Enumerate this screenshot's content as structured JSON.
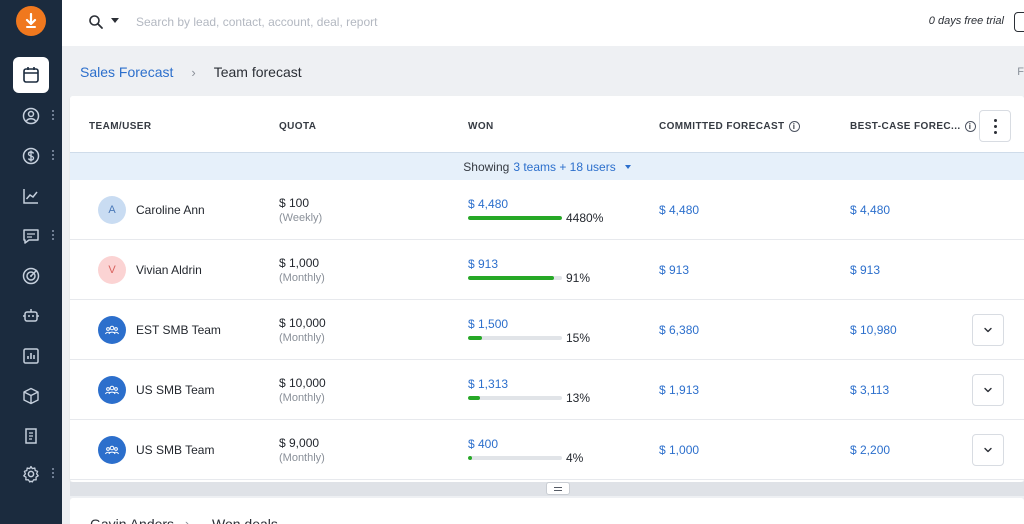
{
  "search": {
    "placeholder": "Search by lead, contact, account, deal, report"
  },
  "trial": {
    "text": "0 days free trial"
  },
  "breadcrumb": {
    "parent": "Sales Forecast",
    "separator": "›",
    "current": "Team forecast"
  },
  "edge_text": "F",
  "table": {
    "headers": {
      "team_user": "TEAM/USER",
      "quota": "QUOTA",
      "won": "WON",
      "committed": "COMMITTED FORECAST",
      "best_case": "BEST-CASE FOREC..."
    },
    "info_glyph": "i",
    "showing": {
      "prefix": "Showing",
      "link": "3 teams + 18 users"
    },
    "rows": [
      {
        "type": "user",
        "initial": "A",
        "name": "Caroline Ann",
        "quota": "$ 100",
        "period": "(Weekly)",
        "won": "$ 4,480",
        "won_pct": "4480%",
        "progress": 1.0,
        "committed": "$ 4,480",
        "best_case": "$ 4,480"
      },
      {
        "type": "user",
        "initial": "V",
        "name": "Vivian Aldrin",
        "quota": "$ 1,000",
        "period": "(Monthly)",
        "won": "$ 913",
        "won_pct": "91%",
        "progress": 0.91,
        "committed": "$ 913",
        "best_case": "$ 913"
      },
      {
        "type": "team",
        "name": "EST SMB Team",
        "quota": "$ 10,000",
        "period": "(Monthly)",
        "won": "$ 1,500",
        "won_pct": "15%",
        "progress": 0.15,
        "committed": "$ 6,380",
        "best_case": "$ 10,980"
      },
      {
        "type": "team",
        "name": "US SMB Team",
        "quota": "$ 10,000",
        "period": "(Monthly)",
        "won": "$ 1,313",
        "won_pct": "13%",
        "progress": 0.13,
        "committed": "$ 1,913",
        "best_case": "$ 3,113"
      },
      {
        "type": "team",
        "name": "US SMB Team",
        "quota": "$ 9,000",
        "period": "(Monthly)",
        "won": "$ 400",
        "won_pct": "4%",
        "progress": 0.04,
        "committed": "$ 1,000",
        "best_case": "$ 2,200"
      }
    ]
  },
  "bottom": {
    "title": "Gavin Anders",
    "separator": "›",
    "subtitle": "Won deals"
  },
  "colors": {
    "sidebar": "#1b2b3e",
    "accent": "#2c6fcc",
    "logo": "#f0781e",
    "progress": "#26a826",
    "avatar_a_bg": "#c9dcf2",
    "avatar_a_fg": "#4a78b8",
    "avatar_v_bg": "#fbd3d3",
    "avatar_v_fg": "#d9625e",
    "team_avatar": "#2c6fcc"
  },
  "icons": {
    "sidebar": [
      "calendar-icon",
      "contact-icon",
      "dollar-icon",
      "chart-line-icon",
      "chat-icon",
      "target-icon",
      "bot-icon",
      "bar-chart-icon",
      "box-icon",
      "document-icon",
      "settings-icon"
    ]
  }
}
